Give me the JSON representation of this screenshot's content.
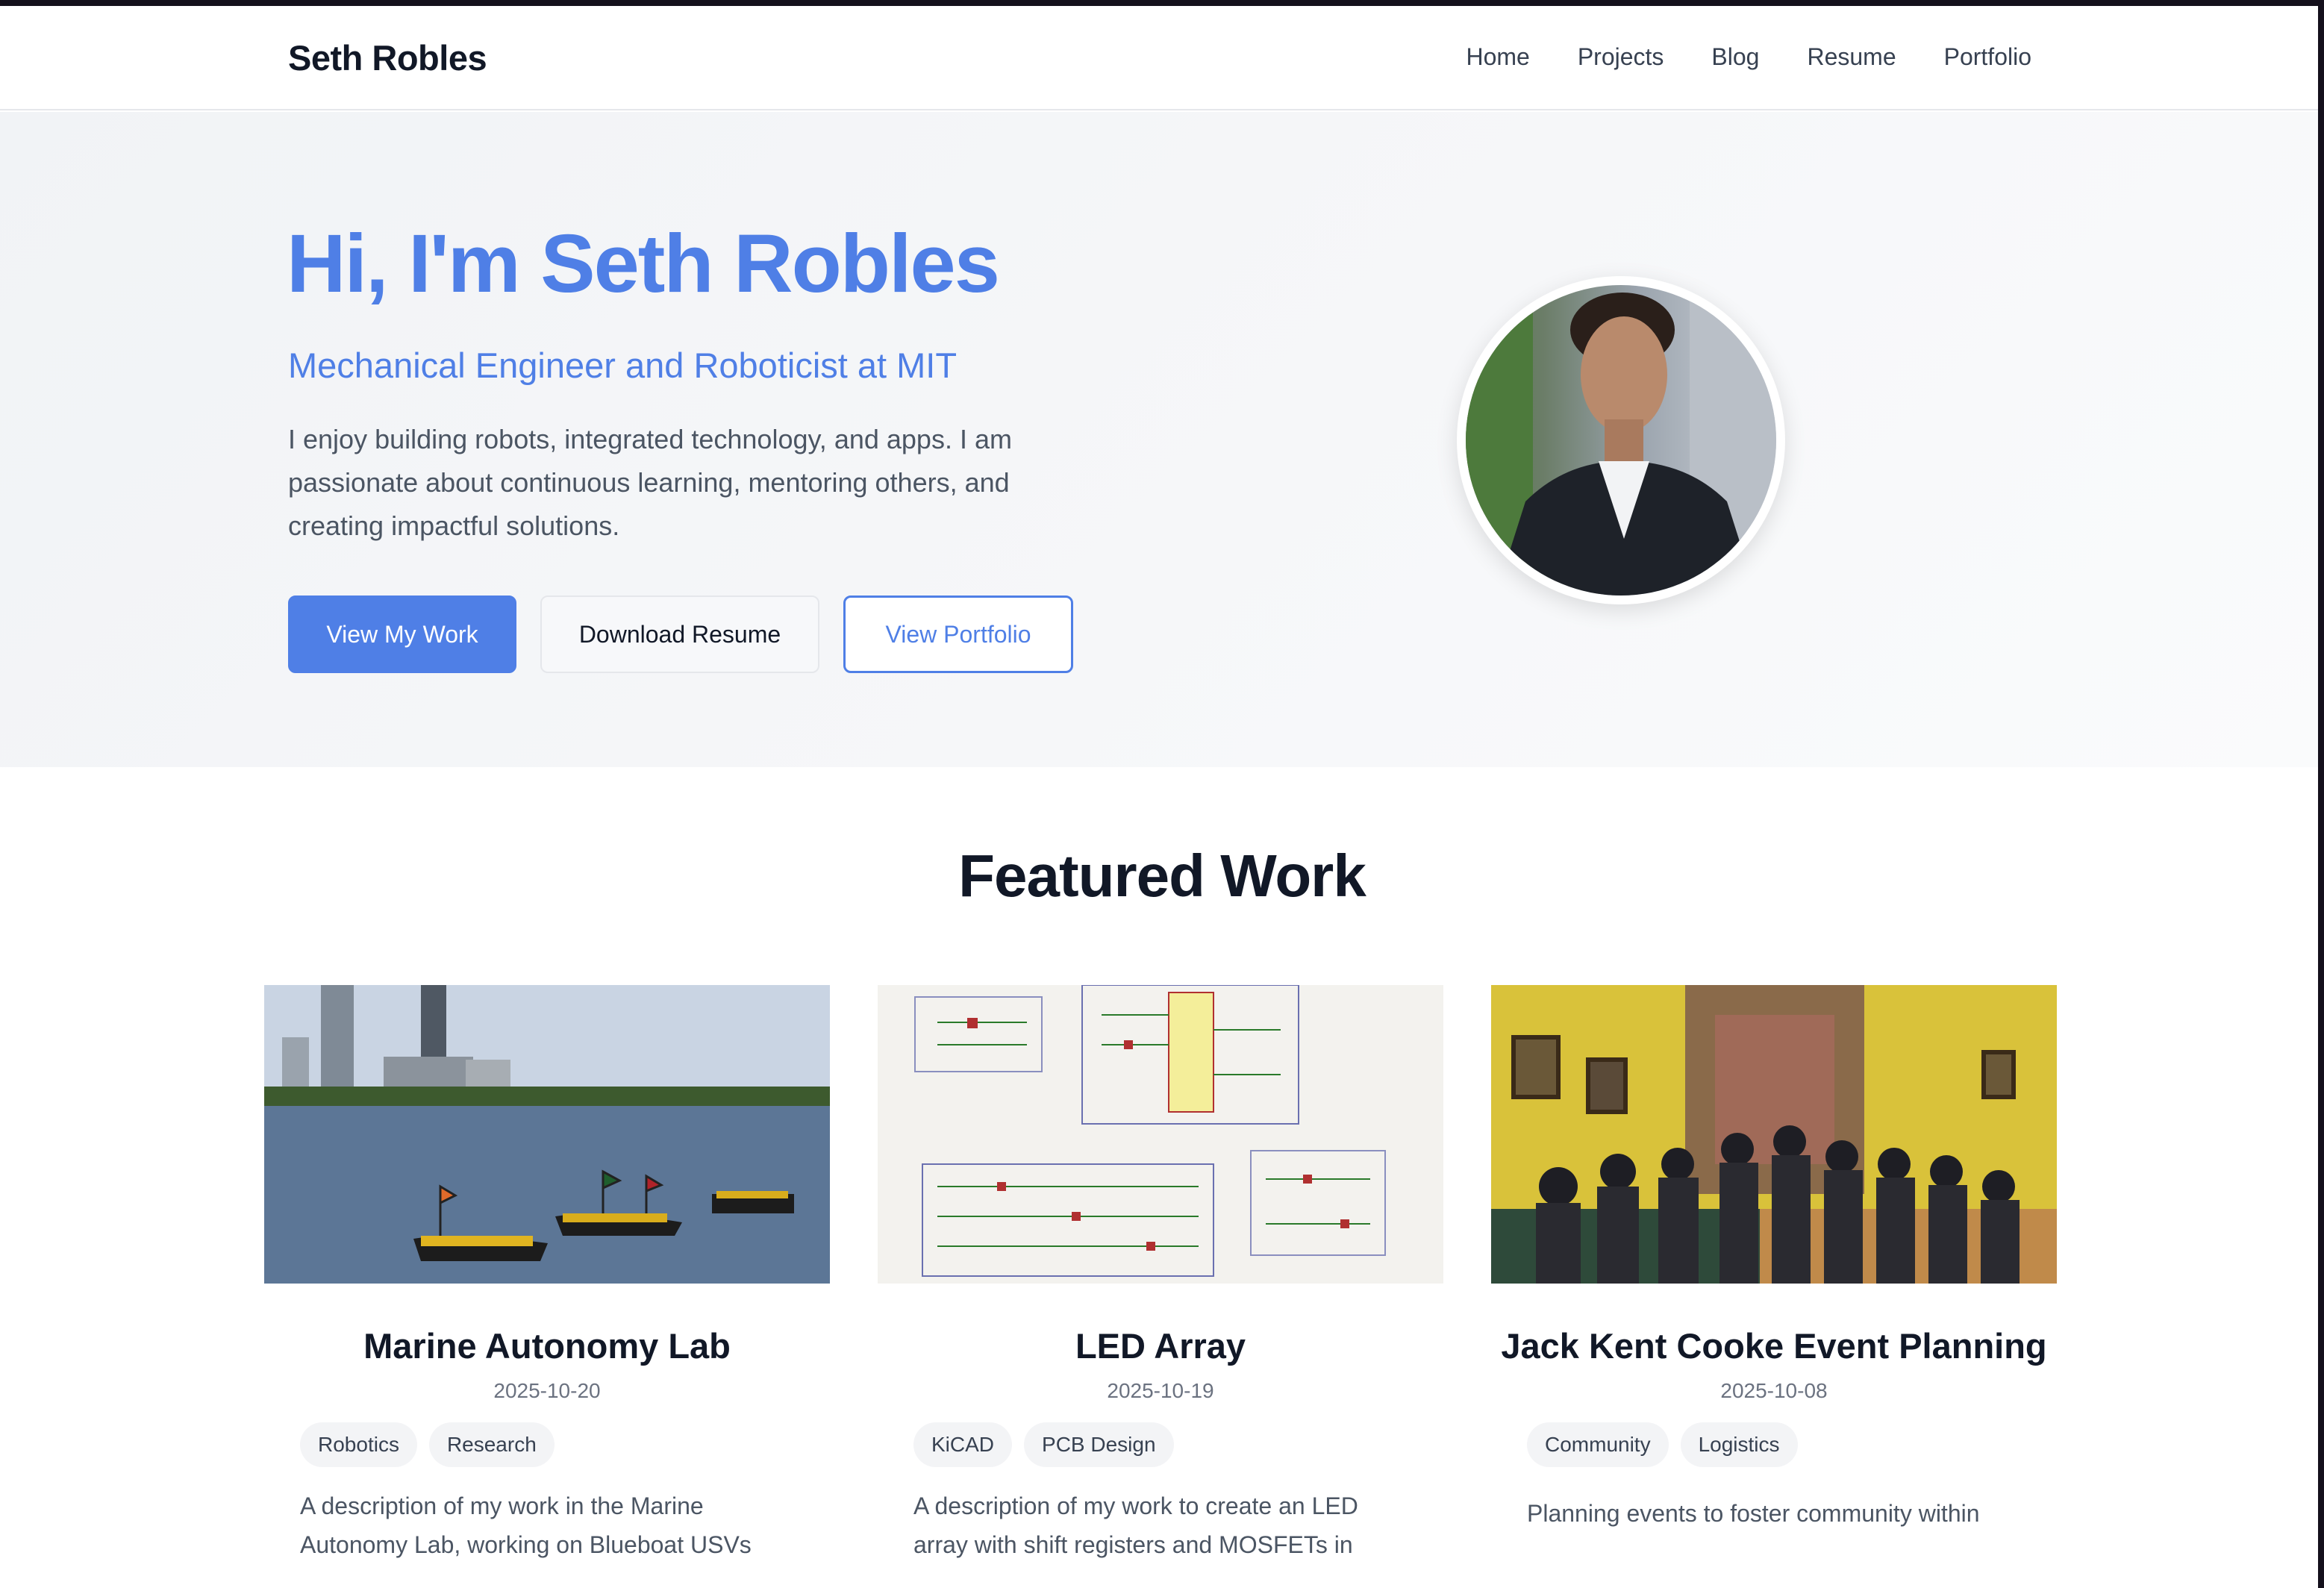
{
  "header": {
    "brand": "Seth Robles",
    "nav": [
      "Home",
      "Projects",
      "Blog",
      "Resume",
      "Portfolio"
    ]
  },
  "hero": {
    "title": "Hi, I'm Seth Robles",
    "subtitle": "Mechanical Engineer and Roboticist at MIT",
    "description": "I enjoy building robots, integrated technology, and apps. I am passionate about continuous learning, mentoring others, and creating impactful solutions.",
    "buttons": {
      "primary": "View My Work",
      "secondary": "Download Resume",
      "outline": "View Portfolio"
    }
  },
  "featured": {
    "title": "Featured Work",
    "cards": [
      {
        "title": "Marine Autonomy Lab",
        "date": "2025-10-20",
        "tags": [
          "Robotics",
          "Research"
        ],
        "description": "A description of my work in the Marine Autonomy Lab, working on Blueboat USVs"
      },
      {
        "title": "LED Array",
        "date": "2025-10-19",
        "tags": [
          "KiCAD",
          "PCB Design"
        ],
        "description": "A description of my work to create an LED array with shift registers and MOSFETs in"
      },
      {
        "title": "Jack Kent Cooke Event Planning",
        "date": "2025-10-08",
        "tags": [
          "Community",
          "Logistics"
        ],
        "description": "Planning events to foster community within"
      }
    ]
  },
  "colors": {
    "accent": "#4f7fe6",
    "text": "#111827",
    "muted": "#4b5563"
  }
}
